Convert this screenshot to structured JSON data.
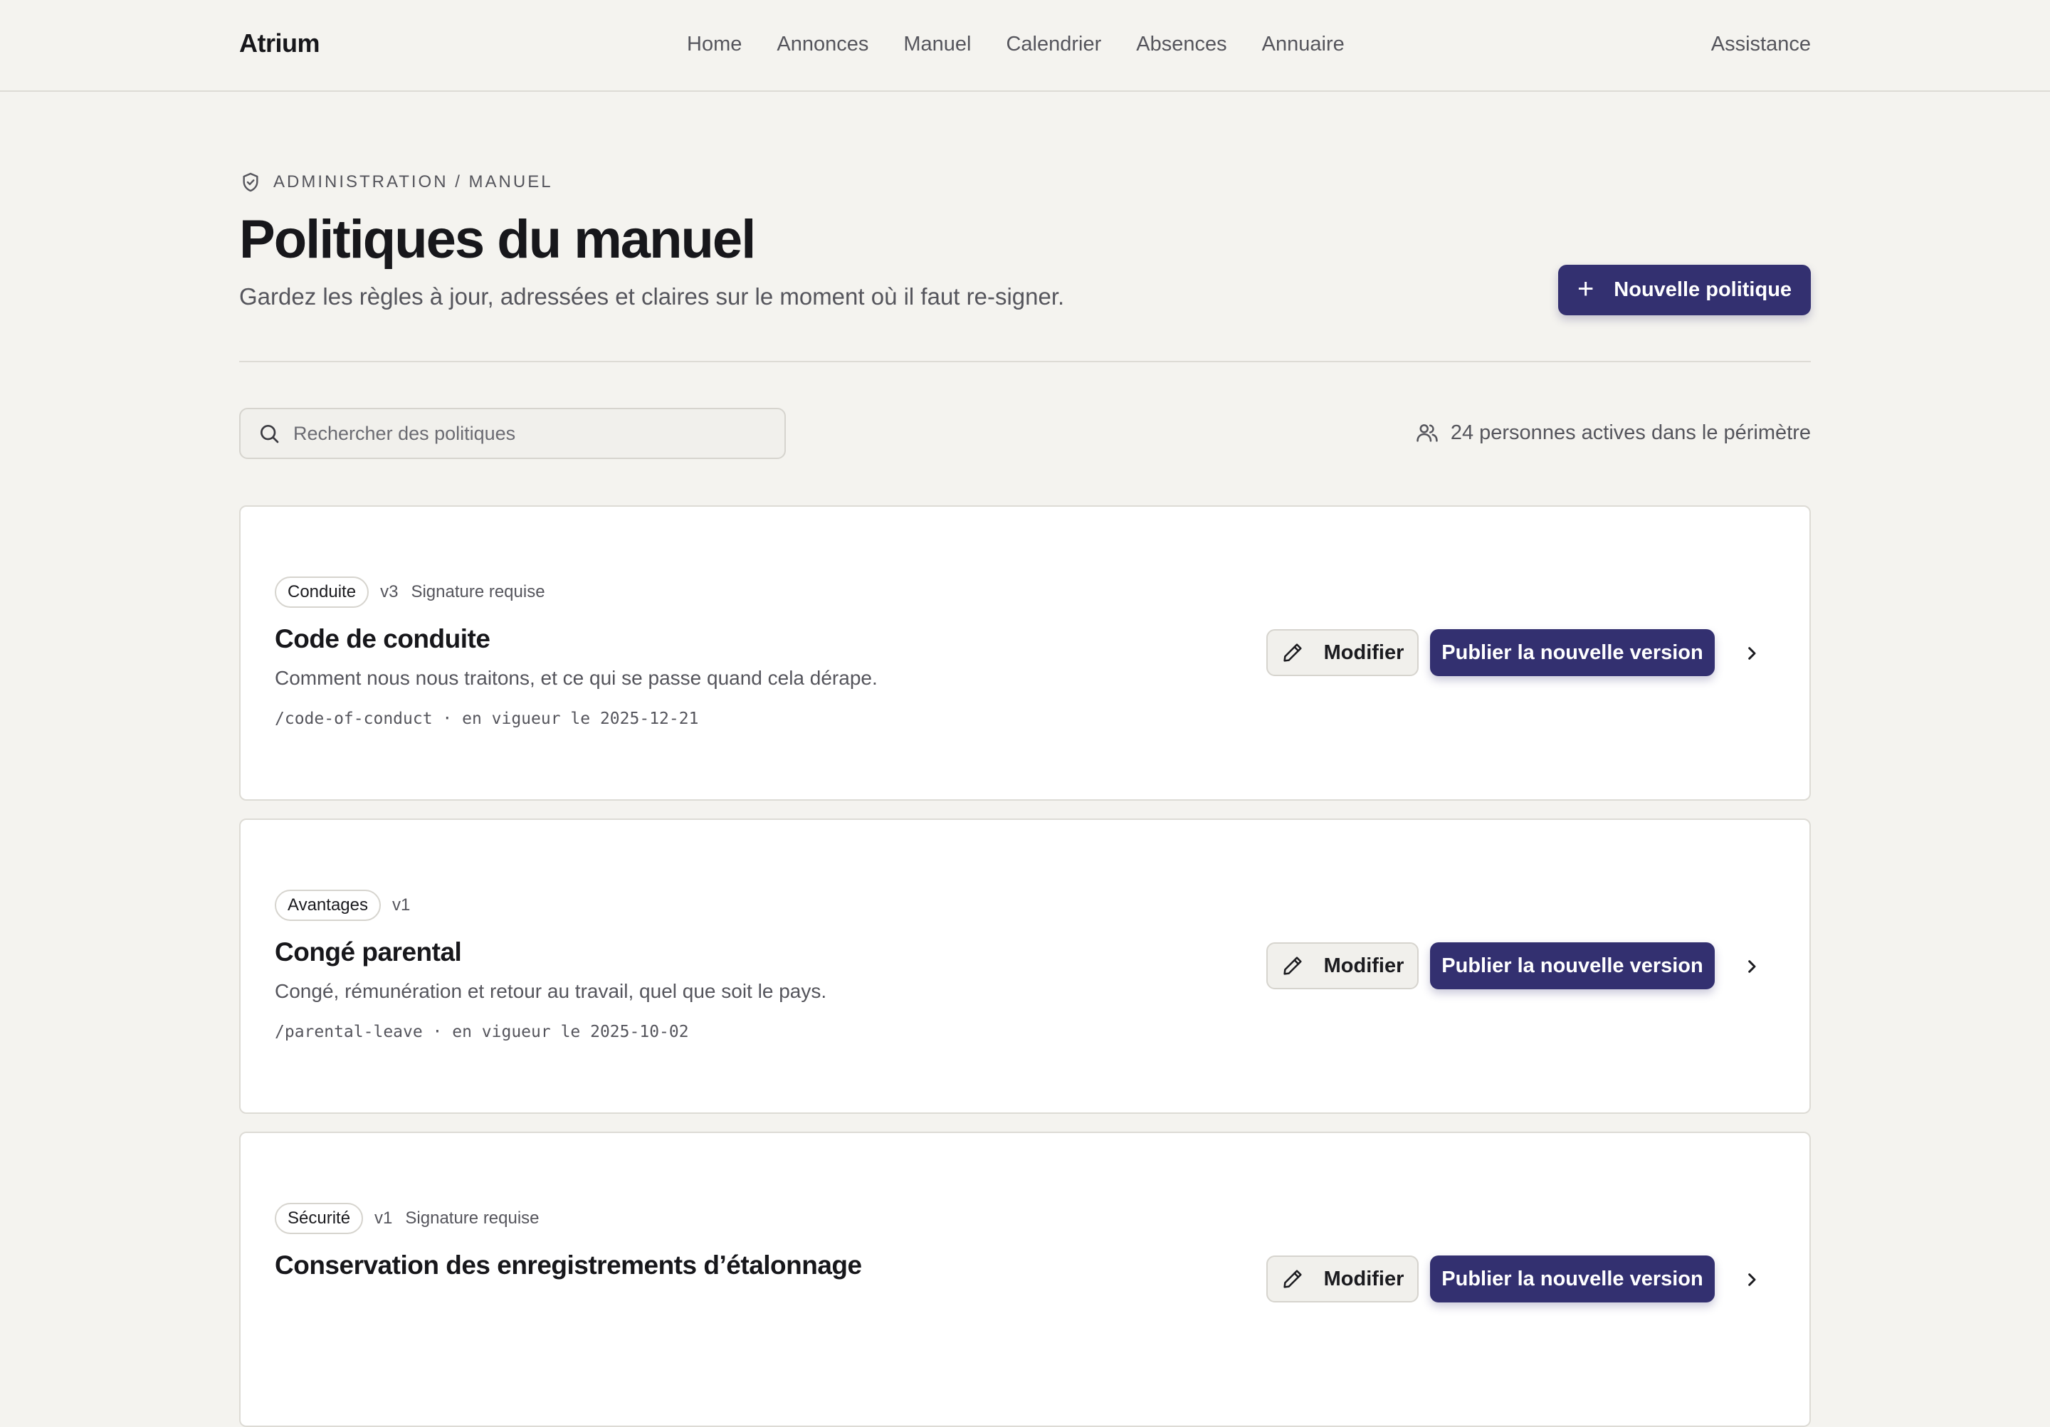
{
  "topbar": {
    "brand": "Atrium",
    "nav": [
      "Home",
      "Annonces",
      "Manuel",
      "Calendrier",
      "Absences",
      "Annuaire"
    ],
    "help": "Assistance"
  },
  "header": {
    "breadcrumb": "Administration / Manuel",
    "breadcrumb_icon": "shield-check-icon",
    "title": "Politiques du manuel",
    "subtitle": "Gardez les règles à jour, adressées et claires sur le moment où il faut re-signer.",
    "new_button": "Nouvelle politique",
    "new_button_icon": "plus-icon"
  },
  "toolbar": {
    "search_placeholder": "Rechercher des politiques",
    "search_value": "",
    "people_text": "24 personnes actives dans le périmètre",
    "people_icon": "users-icon"
  },
  "policies": [
    {
      "category": "Conduite",
      "version": "v3",
      "signature": "Signature requise",
      "title": "Code de conduite",
      "description": "Comment nous nous traitons, et ce qui se passe quand cela dérape.",
      "footer": "/code-of-conduct · en vigueur le 2025-12-21",
      "edit_label": "Modifier",
      "publish_label": "Publier la nouvelle version"
    },
    {
      "category": "Avantages",
      "version": "v1",
      "signature": "",
      "title": "Congé parental",
      "description": "Congé, rémunération et retour au travail, quel que soit le pays.",
      "footer": "/parental-leave · en vigueur le 2025-10-02",
      "edit_label": "Modifier",
      "publish_label": "Publier la nouvelle version"
    },
    {
      "category": "Sécurité",
      "version": "v1",
      "signature": "Signature requise",
      "title": "Conservation des enregistrements d’étalonnage",
      "description": "",
      "footer": "",
      "edit_label": "Modifier",
      "publish_label": "Publier la nouvelle version"
    }
  ],
  "colors": {
    "accent": "#333070",
    "background": "#f4f3ef",
    "card": "#ffffff",
    "border": "#dddbd5",
    "muted_text": "#55555c"
  }
}
